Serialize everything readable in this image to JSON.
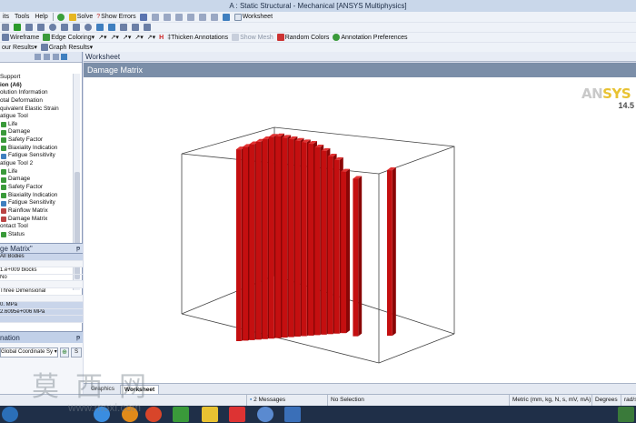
{
  "window": {
    "title": "A : Static Structural - Mechanical [ANSYS Multiphysics]"
  },
  "menubar": {
    "items": [
      "its",
      "Tools",
      "Help"
    ],
    "solve_label": "Solve",
    "show_errors_label": "Show Errors",
    "worksheet_label": "Worksheet"
  },
  "toolbar2": {
    "wireframe_label": "Wireframe",
    "edge_coloring_label": "Edge Coloring"
  },
  "toolbar3": {
    "thicken_label": "Thicken Annotations",
    "show_mesh_label": "Show Mesh",
    "random_colors_label": "Random Colors",
    "annotation_prefs_label": "Annotation Preferences"
  },
  "toolbar4": {
    "contour_label": "our Results",
    "graph_label": "Graph Results"
  },
  "tree": {
    "items": [
      {
        "label": "Support",
        "icon": "none"
      },
      {
        "label": "ion (A6)",
        "icon": "none",
        "bold": true
      },
      {
        "label": "olution Information",
        "icon": "none"
      },
      {
        "label": "otal Deformation",
        "icon": "none"
      },
      {
        "label": "quivalent Elastic Strain",
        "icon": "none"
      },
      {
        "label": "atigue Tool",
        "icon": "none"
      },
      {
        "label": "Life",
        "icon": "result"
      },
      {
        "label": "Damage",
        "icon": "result"
      },
      {
        "label": "Safety Factor",
        "icon": "result"
      },
      {
        "label": "Biaxiality Indication",
        "icon": "result"
      },
      {
        "label": "Fatigue Sensitivity",
        "icon": "sensitivity"
      },
      {
        "label": "atigue Tool 2",
        "icon": "none"
      },
      {
        "label": "Life",
        "icon": "result"
      },
      {
        "label": "Damage",
        "icon": "result"
      },
      {
        "label": "Safety Factor",
        "icon": "result"
      },
      {
        "label": "Biaxiality Indication",
        "icon": "result"
      },
      {
        "label": "Fatigue Sensitivity",
        "icon": "sensitivity"
      },
      {
        "label": "Rainflow Matrix",
        "icon": "matrix"
      },
      {
        "label": "Damage Matrix",
        "icon": "matrix"
      },
      {
        "label": "ontact Tool",
        "icon": "none"
      },
      {
        "label": "Status",
        "icon": "result"
      }
    ]
  },
  "details": {
    "title": "ge Matrix\"",
    "rows": [
      {
        "text": "All Bodies",
        "style": "blue"
      },
      {
        "text": "",
        "style": "gap"
      },
      {
        "text": "1.e+009 blocks",
        "style": "plain"
      },
      {
        "text": "No",
        "style": "plain"
      },
      {
        "text": "",
        "style": "gap"
      },
      {
        "text": "Three Dimensional",
        "style": "plain"
      },
      {
        "text": "",
        "style": "gap"
      },
      {
        "text": "0. MPa",
        "style": "blue"
      },
      {
        "text": "2.6095e+006 MPa",
        "style": "blue"
      },
      {
        "text": "",
        "style": "blue"
      }
    ]
  },
  "information": {
    "title": "nation",
    "coord_system": "Global Coordinate Sy",
    "btn2": "S"
  },
  "main": {
    "tab_label": "Worksheet",
    "header": "Damage Matrix",
    "logo_brand_a": "AN",
    "logo_brand_b": "SYS",
    "logo_version": "14.5"
  },
  "bottom_tabs": {
    "graphics": "Graphics",
    "worksheet": "Worksheet"
  },
  "status": {
    "messages": "2 Messages",
    "selection": "No Selection",
    "units": "Metric (mm, kg, N, s, mV, mA)",
    "angle": "Degrees",
    "rad": "rad/s"
  },
  "colors": {
    "bar_front": "#c40f10",
    "bar_side": "#8a0606",
    "bar_top": "#e23232",
    "header": "#7b8ea8"
  },
  "chart_data": {
    "type": "bar3d",
    "title": "",
    "xlabel": "",
    "ylabel": "",
    "note": "3D damage histogram; heights estimated from relative bar height (normalized to tallest = 1.0)",
    "columns": [
      {
        "category": "c1",
        "value": 0.95
      },
      {
        "category": "c2",
        "value": 0.96
      },
      {
        "category": "c3",
        "value": 0.97
      },
      {
        "category": "c4",
        "value": 0.98
      },
      {
        "category": "c5",
        "value": 0.99
      },
      {
        "category": "c6",
        "value": 1.0
      },
      {
        "category": "c7",
        "value": 1.0
      },
      {
        "category": "c8",
        "value": 0.99
      },
      {
        "category": "c9",
        "value": 0.98
      },
      {
        "category": "c10",
        "value": 0.97
      },
      {
        "category": "c11",
        "value": 0.96
      },
      {
        "category": "c12",
        "value": 0.95
      },
      {
        "category": "c13",
        "value": 0.93
      },
      {
        "category": "c14",
        "value": 0.91
      },
      {
        "category": "c15",
        "value": 0.88
      },
      {
        "category": "c16",
        "value": 0.86
      },
      {
        "category": "c17",
        "value": 0.8
      },
      {
        "category": "c18",
        "value": 0.78
      },
      {
        "category": "c19",
        "value": 0.82
      }
    ]
  }
}
